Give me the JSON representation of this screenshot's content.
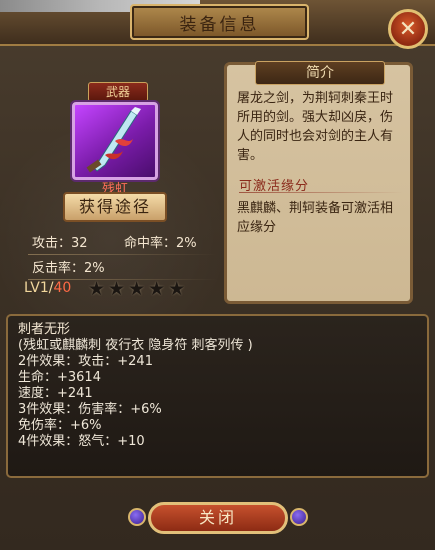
{
  "header": {
    "top_strip_text": "",
    "title": "装备信息",
    "close_icon": "close-x-icon"
  },
  "item": {
    "category": "武器",
    "name": "残虹",
    "get_path_label": "获得途径"
  },
  "stats": {
    "attack": "攻击：32",
    "hit_rate": "命中率：2%",
    "counter_rate": "反击率：2%",
    "level_current": "LV1/",
    "level_max": "40",
    "stars": 5
  },
  "intro": {
    "tab_label": "简介",
    "description": "屠龙之剑，为荆轲刺秦王时所用的剑。强大却凶戾，伤人的同时也会对剑的主人有害。",
    "fate_title": "可激活缘分",
    "fate_description": "黑麒麟、荆轲装备可激活相应缘分"
  },
  "suit": {
    "name": "刺者无形",
    "members": "(残虹或麒麟刺 夜行衣 隐身符 刺客列传 )",
    "lines": [
      "2件效果：攻击：+241",
      "生命：+3614",
      "速度：+241",
      "3件效果：伤害率：+6%",
      "免伤率：+6%",
      "4件效果：怒气：+10"
    ]
  },
  "footer": {
    "close_label": "关闭"
  },
  "colors": {
    "item_quality": "#b03ee8",
    "item_name": "#ff6e5a",
    "level_max": "#ff6a45"
  }
}
